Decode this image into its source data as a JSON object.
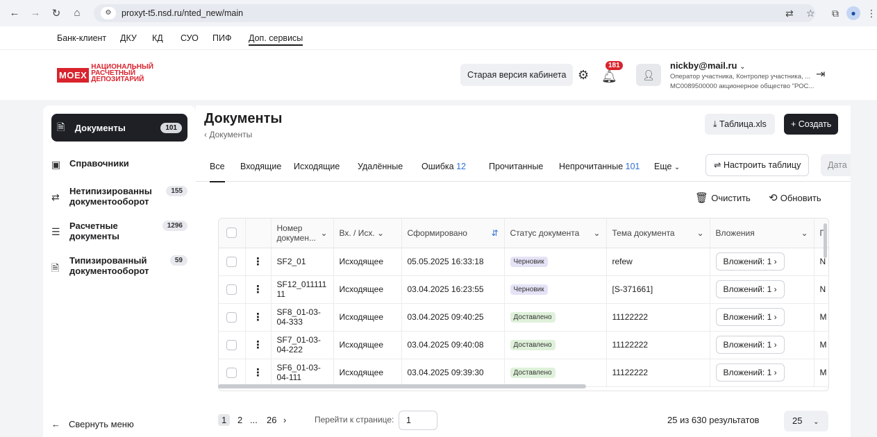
{
  "browser": {
    "url": "proxyt-t5.nsd.ru/nted_new/main"
  },
  "topmenu": {
    "items": [
      "Банк-клиент",
      "ДКУ",
      "КД",
      "СУО",
      "ПИФ",
      "Доп. сервисы"
    ]
  },
  "header": {
    "logo_brand": "MOEX",
    "logo_line1": "НАЦИОНАЛЬНЫЙ",
    "logo_line2": "РАСЧЕТНЫЙ",
    "logo_line3": "ДЕПОЗИТАРИЙ",
    "old_version_label": "Старая версия кабинета",
    "notifications_count": "181",
    "user_email": "nickby@mail.ru",
    "user_role": "Оператор участника, Контролер участника, ...",
    "user_org": "MC0089500000 акционерное общество \"РОС..."
  },
  "sidebar": {
    "items": [
      {
        "label": "Документы",
        "count": "101"
      },
      {
        "label": "Справочники",
        "count": ""
      },
      {
        "label": "Нетипизированны документооборот",
        "count": "155"
      },
      {
        "label": "Расчетные документы",
        "count": "1296"
      },
      {
        "label": "Типизированный документооборот",
        "count": "59"
      }
    ],
    "collapse_label": "Свернуть меню"
  },
  "main": {
    "title": "Документы",
    "breadcrumb": "Документы",
    "xls_label": "Таблица.xls",
    "create_label": "Создать",
    "tabs": [
      {
        "label": "Все",
        "count": ""
      },
      {
        "label": "Входящие",
        "count": ""
      },
      {
        "label": "Исходящие",
        "count": ""
      },
      {
        "label": "Удалённые",
        "count": ""
      },
      {
        "label": "Ошибка",
        "count": "12"
      },
      {
        "label": "Прочитанные",
        "count": ""
      },
      {
        "label": "Непрочитанные",
        "count": "101"
      },
      {
        "label": "Еще",
        "count": ""
      }
    ],
    "configure_label": "Настроить таблицу",
    "date_label": "Дата",
    "clear_label": "Очистить",
    "refresh_label": "Обновить"
  },
  "table": {
    "columns": [
      "Номер докумен...",
      "Вх. / Исх.",
      "Сформировано",
      "Статус документа",
      "Тема документа",
      "Вложения",
      "П"
    ],
    "rows": [
      {
        "number": "SF2_01",
        "direction": "Исходящее",
        "created": "05.05.2025 16:33:18",
        "status": "Черновик",
        "subject": "refew",
        "attachments": "Вложений: 1",
        "extra": "N"
      },
      {
        "number": "SF12_011111 11",
        "direction": "Исходящее",
        "created": "03.04.2025 16:23:55",
        "status": "Черновик",
        "subject": "[S-371661]",
        "attachments": "Вложений: 1",
        "extra": "N"
      },
      {
        "number": "SF8_01-03-04-333",
        "direction": "Исходящее",
        "created": "03.04.2025 09:40:25",
        "status": "Доставлено",
        "subject": "11122222",
        "attachments": "Вложений: 1",
        "extra": "M"
      },
      {
        "number": "SF7_01-03-04-222",
        "direction": "Исходящее",
        "created": "03.04.2025 09:40:08",
        "status": "Доставлено",
        "subject": "11122222",
        "attachments": "Вложений: 1",
        "extra": "M"
      },
      {
        "number": "SF6_01-03-04-111",
        "direction": "Исходящее",
        "created": "03.04.2025 09:39:30",
        "status": "Доставлено",
        "subject": "11122222",
        "attachments": "Вложений: 1",
        "extra": "M"
      }
    ]
  },
  "pagination": {
    "page1": "1",
    "page2": "2",
    "ellipsis": "...",
    "last": "26",
    "goto_label": "Перейти к странице:",
    "goto_value": "1",
    "summary": "25 из 630 результатов",
    "per_page": "25"
  }
}
